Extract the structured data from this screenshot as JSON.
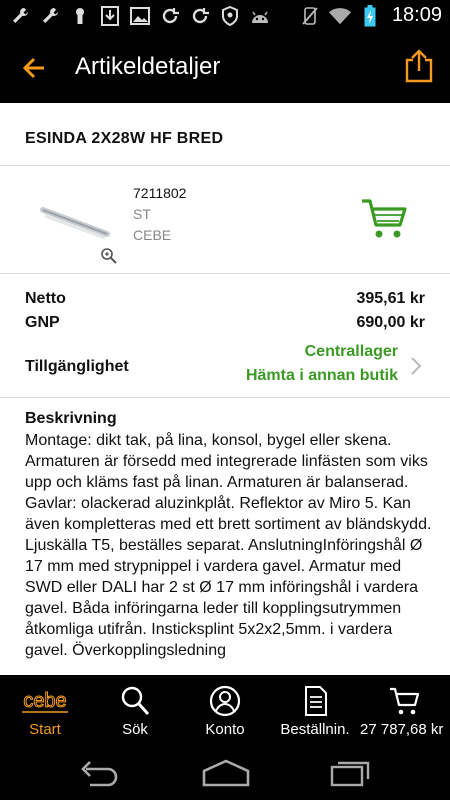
{
  "status_bar": {
    "time": "18:09",
    "left_icons": [
      "wrench-icon",
      "wrench-icon",
      "keyhole-icon",
      "download-icon",
      "image-icon",
      "sync-icon",
      "sync-icon",
      "shield-icon",
      "android-icon"
    ],
    "right_icons": [
      "mute-icon",
      "wifi-icon",
      "battery-icon"
    ]
  },
  "app_bar": {
    "title": "Artikeldetaljer",
    "accent_color": "#f39a1e"
  },
  "product": {
    "name": "ESINDA 2X28W HF BRED",
    "article_number": "7211802",
    "unit": "ST",
    "brand": "CEBE"
  },
  "pricing": {
    "netto_label": "Netto",
    "netto_value": "395,61 kr",
    "gnp_label": "GNP",
    "gnp_value": "690,00 kr"
  },
  "availability": {
    "label": "Tillgänglighet",
    "primary": "Centrallager",
    "secondary": "Hämta i annan butik",
    "color": "#3a9a24"
  },
  "description": {
    "heading": "Beskrivning",
    "text": "Montage: dikt tak, på lina, konsol, bygel eller skena. Armaturen är försedd med integrerade linfästen som viks upp och kläms fast på linan. Armaturen är balanserad. Gavlar: olackerad aluzinkplåt. Reflektor av Miro 5. Kan även kompletteras med ett brett sortiment av bländskydd. Ljuskälla T5, beställes separat. AnslutningInföringshål Ø 17 mm med strypnippel i vardera gavel. Armatur med SWD eller DALI har 2 st Ø 17 mm införingshål i vardera gavel. Båda införingarna leder till kopplingsutrymmen åtkomliga utifrån. Insticksplint 5x2x2,5mm. i vardera gavel. Överkopplingsledning"
  },
  "bottom_nav": {
    "logo_text": "cebe",
    "items": [
      {
        "label": "Start",
        "icon": "cebe-logo-icon",
        "active": true
      },
      {
        "label": "Sök",
        "icon": "search-icon"
      },
      {
        "label": "Konto",
        "icon": "account-icon"
      },
      {
        "label": "Beställnin.",
        "icon": "orders-icon"
      },
      {
        "label": "27 787,68 kr",
        "icon": "cart-icon"
      }
    ]
  },
  "system_nav": [
    "back-icon",
    "home-icon",
    "recents-icon"
  ]
}
